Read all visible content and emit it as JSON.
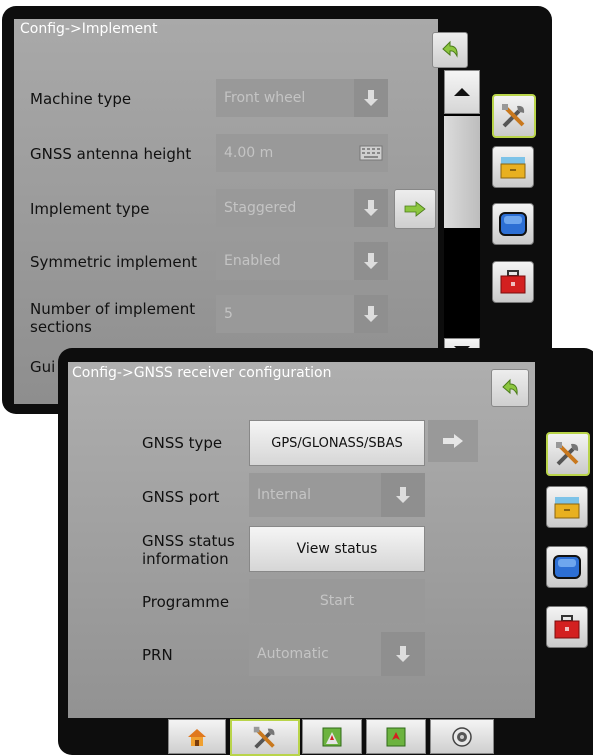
{
  "back_screen": {
    "title": "Config->Implement",
    "rows": [
      {
        "label": "Machine type",
        "value": "Front wheel",
        "control": "dropdown"
      },
      {
        "label": "GNSS antenna height",
        "value": "4.00 m",
        "control": "keyboard"
      },
      {
        "label": "Implement type",
        "value": "Staggered",
        "control": "dropdown"
      },
      {
        "label": "Symmetric implement",
        "value": "Enabled",
        "control": "dropdown"
      },
      {
        "label": "Number of implement sections",
        "value": "5",
        "control": "dropdown"
      },
      {
        "label": "Gui",
        "value": "",
        "control": "dropdown"
      }
    ]
  },
  "front_screen": {
    "title": "Config->GNSS receiver configuration",
    "rows": [
      {
        "label": "GNSS type",
        "value": "GPS/GLONASS/SBAS"
      },
      {
        "label": "GNSS port",
        "value": "Internal"
      },
      {
        "label": "GNSS status information",
        "value": "View status"
      },
      {
        "label": "Programme",
        "value": "Start"
      },
      {
        "label": "PRN",
        "value": "Automatic"
      }
    ]
  },
  "side_tabs": [
    "tools-icon",
    "implement-icon",
    "display-icon",
    "toolbox-icon"
  ],
  "bottom_tabs": [
    "home-icon",
    "tools-icon",
    "field-icon",
    "guidance-icon",
    "camera-icon"
  ],
  "colors": {
    "accent_green": "#8cc63f",
    "active_border": "#b9d44a",
    "toolbox_red": "#d32020",
    "display_blue": "#2d6fd4"
  }
}
